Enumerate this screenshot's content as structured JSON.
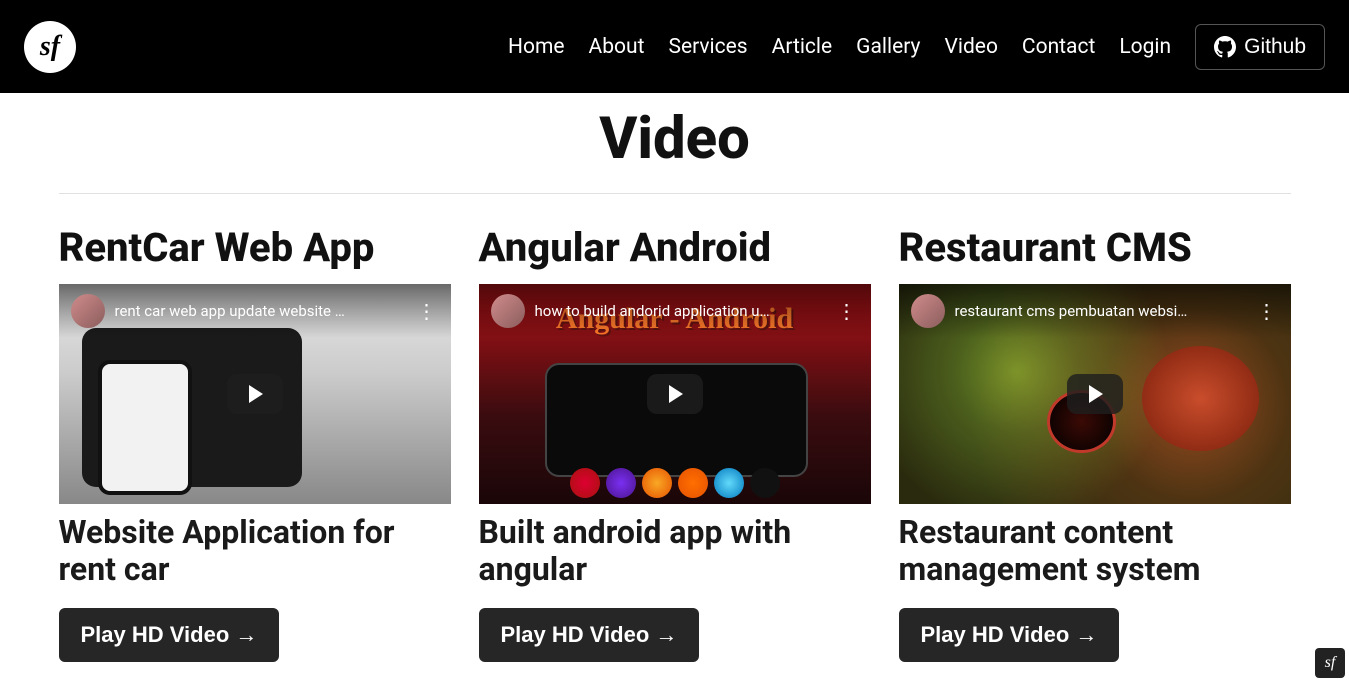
{
  "nav": {
    "items": [
      {
        "label": "Home"
      },
      {
        "label": "About"
      },
      {
        "label": "Services"
      },
      {
        "label": "Article"
      },
      {
        "label": "Gallery"
      },
      {
        "label": "Video"
      },
      {
        "label": "Contact"
      },
      {
        "label": "Login"
      }
    ],
    "github_label": "Github"
  },
  "page": {
    "title": "Video"
  },
  "videos": [
    {
      "title": "RentCar Web App",
      "embed_title": "rent car web app update website …",
      "subtitle": "Website Application for rent car",
      "button": "Play HD Video →"
    },
    {
      "title": "Angular Android",
      "embed_title": "how to build andorid application u…",
      "subtitle": "Built android app with angular",
      "button": "Play HD Video →"
    },
    {
      "title": "Restaurant CMS",
      "embed_title": "restaurant cms pembuatan websi…",
      "subtitle": "Restaurant content management system",
      "button": "Play HD Video →"
    }
  ]
}
